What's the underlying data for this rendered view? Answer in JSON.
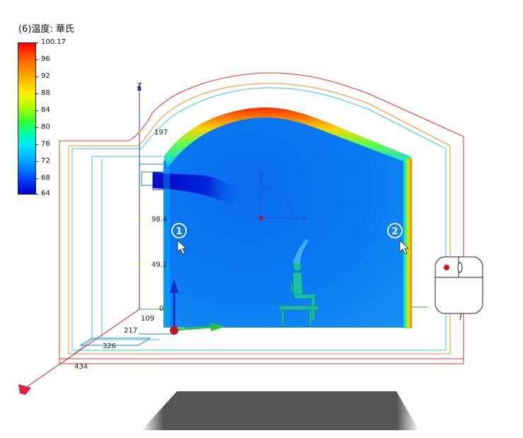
{
  "legend": {
    "title": "(6)温度: 華氏",
    "ticks": [
      "100.17",
      "96",
      "92",
      "88",
      "84",
      "80",
      "76",
      "72",
      "68",
      "64"
    ],
    "colors": [
      "#ff0000",
      "#ffaa00",
      "#ffee00",
      "#33ff33",
      "#00e5ff",
      "#0099ff",
      "#0000cc"
    ]
  },
  "axis": {
    "z_label": "Z",
    "z_ticks": [
      "197",
      "98.4",
      "49.2",
      "0"
    ],
    "x_ticks": [
      "109",
      "217",
      "326",
      "434"
    ]
  },
  "markers": {
    "marker1": "1",
    "marker2": "2"
  }
}
